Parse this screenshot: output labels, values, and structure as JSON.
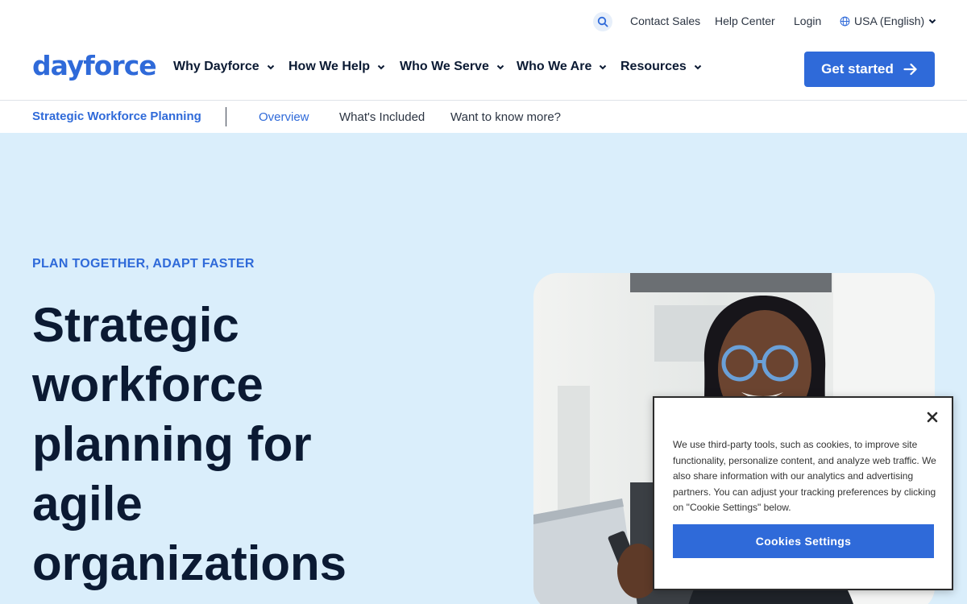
{
  "utility": {
    "search_icon": "search-icon",
    "contact_sales": "Contact Sales",
    "help_center": "Help Center",
    "login": "Login",
    "language": "USA (English)"
  },
  "header": {
    "logo": "dayforce",
    "nav": [
      {
        "label": "Why Dayforce"
      },
      {
        "label": "How We Help"
      },
      {
        "label": "Who We Serve"
      },
      {
        "label": "Who We Are"
      },
      {
        "label": "Resources"
      }
    ],
    "cta_label": "Get started"
  },
  "subnav": {
    "title": "Strategic Workforce Planning",
    "links": [
      "Overview",
      "What's Included",
      "Want to know more?"
    ],
    "active": "Overview"
  },
  "hero": {
    "eyebrow": "PLAN TOGETHER, ADAPT FASTER",
    "headline_lines": [
      "Strategic",
      "workforce",
      "planning for",
      "agile",
      "organizations"
    ]
  },
  "cookie": {
    "text": "We use third-party tools, such as cookies, to improve site functionality, personalize content, and analyze web traffic. We also share information with our analytics and advertising partners. You can adjust your tracking preferences by clicking on \"Cookie Settings\" below.",
    "button_label": "Cookies Settings"
  },
  "colors": {
    "brand": "#2f6ad9",
    "hero_bg": "#daeefb",
    "text_dark": "#0b1a33"
  }
}
